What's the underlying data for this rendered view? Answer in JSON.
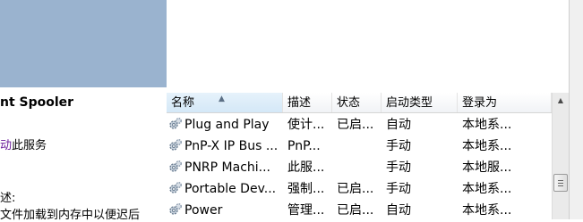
{
  "left_panel": {
    "service_title": "nt Spooler",
    "action_link": "动",
    "action_rest": "此服务",
    "description_label": "述:",
    "description_text": "文件加载到内存中以便迟后"
  },
  "list": {
    "columns": [
      "名称",
      "描述",
      "状态",
      "启动类型",
      "登录为"
    ],
    "sorted_column": "名称",
    "rows": [
      {
        "name": "Plug and Play",
        "desc": "使计...",
        "status": "已启...",
        "start": "自动",
        "logon": "本地系..."
      },
      {
        "name": "PnP-X IP Bus ...",
        "desc": "PnP...",
        "status": "",
        "start": "手动",
        "logon": "本地系..."
      },
      {
        "name": "PNRP Machi...",
        "desc": "此服...",
        "status": "",
        "start": "手动",
        "logon": "本地服..."
      },
      {
        "name": "Portable Dev...",
        "desc": "强制...",
        "status": "已启...",
        "start": "手动",
        "logon": "本地系..."
      },
      {
        "name": "Power",
        "desc": "管理...",
        "status": "已启...",
        "start": "自动",
        "logon": "本地系..."
      }
    ]
  },
  "icons": {
    "service": "gear-icon",
    "sort": "sort-up-arrow-icon",
    "scroll_up": "scroll-up-arrow-icon"
  },
  "colors": {
    "left_header_block": "#9ab3cf",
    "action_link": "#6a1b9a"
  }
}
